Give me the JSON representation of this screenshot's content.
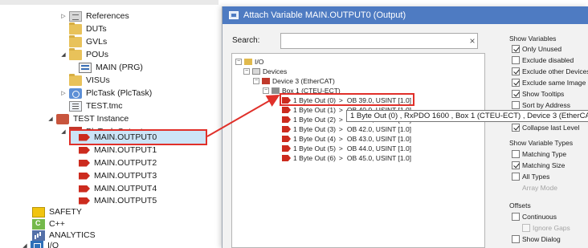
{
  "tree": {
    "items": [
      {
        "label": "References"
      },
      {
        "label": "DUTs"
      },
      {
        "label": "GVLs"
      },
      {
        "label": "POUs"
      },
      {
        "label": "MAIN (PRG)"
      },
      {
        "label": "VISUs"
      },
      {
        "label": "PlcTask (PlcTask)"
      },
      {
        "label": "TEST.tmc"
      },
      {
        "label": "TEST Instance"
      },
      {
        "label": "PlcTask Outputs"
      },
      {
        "label": "MAIN.OUTPUT0"
      },
      {
        "label": "MAIN.OUTPUT1"
      },
      {
        "label": "MAIN.OUTPUT2"
      },
      {
        "label": "MAIN.OUTPUT3"
      },
      {
        "label": "MAIN.OUTPUT4"
      },
      {
        "label": "MAIN.OUTPUT5"
      },
      {
        "label": "SAFETY"
      },
      {
        "label": "C++"
      },
      {
        "label": "ANALYTICS"
      },
      {
        "label": "I/O"
      }
    ]
  },
  "dialog": {
    "title": "Attach Variable MAIN.OUTPUT0 (Output)",
    "search_label": "Search:",
    "search_value": "",
    "clear_glyph": "×",
    "tree": {
      "io": "I/O",
      "devices": "Devices",
      "device3": "Device 3 (EtherCAT)",
      "box1": "Box 1 (CTEU-ECT)",
      "outputs": [
        {
          "label": "1 Byte Out (0)",
          "addr": "OB 39.0, USINT [1.0]"
        },
        {
          "label": "1 Byte Out (1)",
          "addr": "OB 40.0, USINT [1.0]"
        },
        {
          "label": "1 Byte Out (2)",
          "addr": "OB 41.0, USINT [1.0]"
        },
        {
          "label": "1 Byte Out (3)",
          "addr": "OB 42.0, USINT [1.0]"
        },
        {
          "label": "1 Byte Out (4)",
          "addr": "OB 43.0, USINT [1.0]"
        },
        {
          "label": "1 Byte Out (5)",
          "addr": "OB 44.0, USINT [1.0]"
        },
        {
          "label": "1 Byte Out (6)",
          "addr": "OB 45.0, USINT [1.0]"
        }
      ],
      "gt": ">"
    },
    "tooltip": "1 Byte Out (0) , RxPDO 1600 , Box 1 (CTEU-ECT) , Device 3 (EtherCAT)",
    "options": {
      "show_variables": {
        "title": "Show Variables",
        "items": [
          {
            "label": "Only Unused",
            "checked": true
          },
          {
            "label": "Exclude disabled",
            "checked": false
          },
          {
            "label": "Exclude other Devices",
            "checked": true
          },
          {
            "label": "Exclude same Image",
            "checked": true
          },
          {
            "label": "Show Tooltips",
            "checked": true
          },
          {
            "label": "Sort by Address",
            "checked": false
          },
          {
            "label": "Collapse last Level",
            "checked": true
          }
        ]
      },
      "show_variable_types": {
        "title": "Show Variable Types",
        "items": [
          {
            "label": "Matching Type",
            "checked": false
          },
          {
            "label": "Matching Size",
            "checked": true
          },
          {
            "label": "All Types",
            "checked": false
          },
          {
            "label": "Array Mode",
            "checked": false,
            "disabled": true
          }
        ]
      },
      "offsets": {
        "title": "Offsets",
        "items": [
          {
            "label": "Continuous",
            "checked": false
          },
          {
            "label": "Ignore Gaps",
            "checked": false,
            "disabled": true
          },
          {
            "label": "Show Dialog",
            "checked": false
          }
        ]
      }
    }
  },
  "colors": {
    "titlebar": "#4e7bc2",
    "highlight_red": "#e0302a",
    "selection": "#cce4f7"
  },
  "icons": [
    "folder-icon",
    "references-icon",
    "program-icon",
    "task-icon",
    "tmc-file-icon",
    "instance-icon",
    "task-outputs-icon",
    "output-variable-icon",
    "safety-icon",
    "cpp-icon",
    "analytics-icon",
    "io-icon"
  ]
}
